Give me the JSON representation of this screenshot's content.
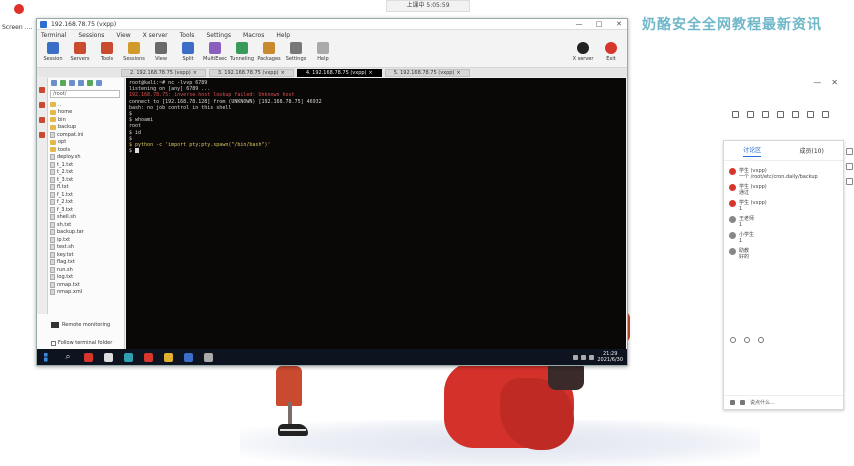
{
  "desktop": {
    "top_banner": "上课中 5:05:59",
    "icon_label": "Screen ....",
    "right_banner": "奶酪安全全网教程最新资讯"
  },
  "window": {
    "title": "192.168.78.75 (vxpp)",
    "controls": [
      "—",
      "□",
      "✕"
    ],
    "menu": [
      "Terminal",
      "Sessions",
      "View",
      "X server",
      "Tools",
      "Settings",
      "Macros",
      "Help"
    ],
    "toolbar": [
      {
        "label": "Session",
        "icon": "session-icon",
        "color": "#3b6fc7"
      },
      {
        "label": "Servers",
        "icon": "servers-icon",
        "color": "#c94a2f"
      },
      {
        "label": "Tools",
        "icon": "tools-icon",
        "color": "#c94a2f"
      },
      {
        "label": "Sessions",
        "icon": "sessions-icon",
        "color": "#d29a2a"
      },
      {
        "label": "View",
        "icon": "view-icon",
        "color": "#6a6a6a"
      },
      {
        "label": "Split",
        "icon": "split-icon",
        "color": "#3b6fc7"
      },
      {
        "label": "MultiExec",
        "icon": "multiexec-icon",
        "color": "#8a5fc0"
      },
      {
        "label": "Tunneling",
        "icon": "tunneling-icon",
        "color": "#3a9a5a"
      },
      {
        "label": "Packages",
        "icon": "packages-icon",
        "color": "#c98a2f"
      },
      {
        "label": "Settings",
        "icon": "settings-icon",
        "color": "#777777"
      },
      {
        "label": "Help",
        "icon": "help-icon",
        "color": "#aaaaaa"
      }
    ],
    "toolbar_right": [
      {
        "label": "X server",
        "icon": "x-server-icon",
        "color": "#222222"
      },
      {
        "label": "Exit",
        "icon": "exit-icon",
        "color": "#d7362c"
      }
    ],
    "tabs": [
      {
        "label": "2. 192.168.78.75 (vxpp)",
        "active": false
      },
      {
        "label": "3. 192.168.78.75 (vxpp)",
        "active": false
      },
      {
        "label": "4. 192.168.78.75 (vxpp)",
        "active": true
      },
      {
        "label": "5. 192.168.78.75 (vxpp)",
        "active": false
      }
    ]
  },
  "sidebar": {
    "path": "/root/",
    "tree": [
      {
        "name": "..",
        "type": "folder"
      },
      {
        "name": "home",
        "type": "folder"
      },
      {
        "name": "bin",
        "type": "folder"
      },
      {
        "name": "backup",
        "type": "folder"
      },
      {
        "name": "compat.ini",
        "type": "file"
      },
      {
        "name": "opt",
        "type": "folder"
      },
      {
        "name": "tools",
        "type": "folder"
      },
      {
        "name": "deploy.sh",
        "type": "file"
      },
      {
        "name": "t_1.txt",
        "type": "file"
      },
      {
        "name": "t_2.txt",
        "type": "file"
      },
      {
        "name": "t_3.txt",
        "type": "file"
      },
      {
        "name": "fl.txt",
        "type": "file"
      },
      {
        "name": "f_1.txt",
        "type": "file"
      },
      {
        "name": "f_2.txt",
        "type": "file"
      },
      {
        "name": "f_3.txt",
        "type": "file"
      },
      {
        "name": "shell.sh",
        "type": "file"
      },
      {
        "name": "sh.txt",
        "type": "file"
      },
      {
        "name": "backup.tar",
        "type": "file"
      },
      {
        "name": "ip.txt",
        "type": "file"
      },
      {
        "name": "test.sh",
        "type": "file"
      },
      {
        "name": "key.txt",
        "type": "file"
      },
      {
        "name": "flag.txt",
        "type": "file"
      },
      {
        "name": "run.sh",
        "type": "file"
      },
      {
        "name": "log.txt",
        "type": "file"
      },
      {
        "name": "nmap.txt",
        "type": "file"
      },
      {
        "name": "nmap.xml",
        "type": "file"
      }
    ],
    "remote_monitoring": "Remote monitoring",
    "follow_terminal": "Follow terminal folder"
  },
  "terminal": {
    "lines": [
      {
        "text": "root@kali:~# nc -lvvp 6789",
        "cls": ""
      },
      {
        "text": "listening on [any] 6789 ...",
        "cls": ""
      },
      {
        "text": "192.168.78.75: inverse host lookup failed: Unknown host",
        "cls": "r"
      },
      {
        "text": "connect to [192.168.78.128] from (UNKNOWN) [192.168.78.75] 46932",
        "cls": ""
      },
      {
        "text": "bash: no job control in this shell",
        "cls": ""
      },
      {
        "text": "$ ",
        "cls": ""
      },
      {
        "text": "$ whoami",
        "cls": ""
      },
      {
        "text": "root",
        "cls": ""
      },
      {
        "text": "$ id",
        "cls": ""
      },
      {
        "text": "$ ",
        "cls": ""
      },
      {
        "text": "$ python -c 'import pty;pty.spawn(\"/bin/bash\")'",
        "cls": "y"
      },
      {
        "text": "$ ",
        "cls": "cursor"
      }
    ]
  },
  "taskbar": {
    "items": [
      {
        "name": "start-button",
        "color": "#3a8be0"
      },
      {
        "name": "search-icon",
        "color": "#dddddd"
      },
      {
        "name": "app-red",
        "color": "#d7362c"
      },
      {
        "name": "app-white",
        "color": "#dddddd"
      },
      {
        "name": "app-teal",
        "color": "#2fa0b0"
      },
      {
        "name": "app-orange",
        "color": "#d7362c"
      },
      {
        "name": "app-chrome",
        "color": "#e0b030"
      },
      {
        "name": "app-blue",
        "color": "#3b6fc7"
      },
      {
        "name": "app-grey",
        "color": "#aaaaaa"
      }
    ],
    "time": "21:29",
    "date": "2021/6/30"
  },
  "panel": {
    "tabs": [
      "讨论区",
      "成员(10)"
    ],
    "messages": [
      {
        "user": "学生 (vxpp)",
        "text": "一个 /root/etc/cron.daily/backup",
        "avatar": "red"
      },
      {
        "user": "学生 (vxpp)",
        "text": "通过",
        "avatar": "red"
      },
      {
        "user": "学生 (vxpp)",
        "text": "1",
        "avatar": "red"
      },
      {
        "user": "王老师",
        "text": "1",
        "avatar": "grey"
      },
      {
        "user": "小学生",
        "text": "1",
        "avatar": "grey"
      },
      {
        "user": "助教",
        "text": "好的",
        "avatar": "grey"
      }
    ],
    "bottom_label": "说点什么..."
  }
}
